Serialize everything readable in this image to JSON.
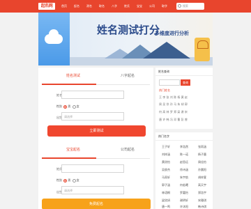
{
  "header": {
    "logo": "起名网",
    "nav": [
      "首页",
      "起名",
      "测名",
      "取名",
      "八字",
      "姓氏",
      "宝宝",
      "公司",
      "取字"
    ],
    "search_placeholder": "搜索"
  },
  "banner": {
    "title": "姓名测试打分",
    "subtitle": "多维度进行分析"
  },
  "form1": {
    "tab_active": "姓名测试",
    "tab_inactive": "八字起名",
    "name_label": "姓名",
    "gender_label": "性别",
    "gender_male": "男",
    "gender_female": "女",
    "birth_label": "出生",
    "birth_placeholder": "请选择",
    "button": "立即测试"
  },
  "form2": {
    "tab_active": "宝宝起名",
    "tab_inactive": "公司起名",
    "name_label": "姓氏",
    "gender_label": "性别",
    "gender_male": "男",
    "gender_female": "女",
    "birth_label": "出生",
    "birth_placeholder": "请选择",
    "button": "免费起名"
  },
  "sidebar1": {
    "title": "姓名查询",
    "search_button": "查询",
    "link": "热门姓名",
    "lines": [
      "王 李 张 刘 陈 杨 黄 赵",
      "周 吴 徐 孙 马 朱 胡 郭",
      "何 高 林 罗 郑 梁 谢 宋",
      "唐 许 韩 冯 邓 曹 彭 曾"
    ]
  },
  "sidebar2": {
    "title": "热门名字",
    "items": [
      [
        "王子轩",
        "李浩然",
        "张雨涵"
      ],
      [
        "刘梓涵",
        "陈一诺",
        "杨子墨"
      ],
      [
        "黄欣怡",
        "赵思远",
        "周佳怡"
      ],
      [
        "吴俊杰",
        "徐诗涵",
        "孙晨阳"
      ],
      [
        "马雨轩",
        "朱宇航",
        "胡梓萱"
      ],
      [
        "郭子涵",
        "何若曦",
        "高天宇"
      ],
      [
        "林语桐",
        "罗嘉怡",
        "郑浩宇"
      ],
      [
        "梁欣妍",
        "谢明轩",
        "宋雅琪"
      ],
      [
        "唐一鸣",
        "许沐阳",
        "韩诗琪"
      ]
    ]
  }
}
